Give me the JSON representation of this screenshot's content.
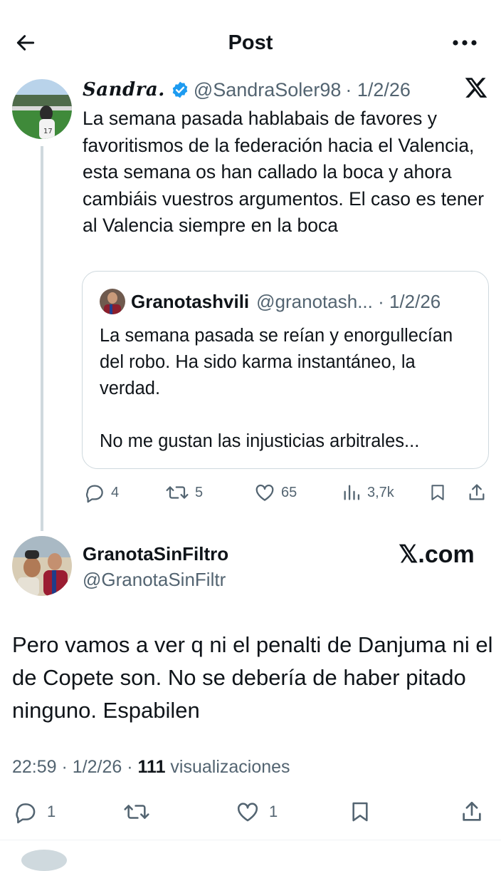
{
  "header": {
    "title": "Post"
  },
  "parent_tweet": {
    "name": "Sandra.",
    "handle": "@SandraSoler98",
    "date": "· 1/2/26",
    "text": "La semana pasada hablabais de favores y favoritismos de la federación hacia el Valencia, esta semana os han callado la boca y ahora cambiáis vuestros argumentos. El caso es tener al Valencia siempre en la boca",
    "quoted": {
      "name": "Granotashvili",
      "handle_date": "@granotash... · 1/2/26",
      "text": "La semana pasada se reían y enorgullecían del robo. Ha sido karma instantáneo, la verdad.\n\nNo me gustan las injusticias arbitrales..."
    },
    "actions": {
      "replies": "4",
      "reposts": "5",
      "likes": "65",
      "views": "3,7k"
    }
  },
  "reply_tweet": {
    "name": "GranotaSinFiltro",
    "handle": "@GranotaSinFiltr",
    "brand": "𝕏.com",
    "text": "Pero vamos a ver q ni el penalti de Danjuma ni el de Copete son. No se debería de haber pitado ninguno. Espabilen",
    "time_date": "22:59 · 1/2/26 · ",
    "views_count": "111",
    "views_label": " visualizaciones",
    "actions": {
      "replies": "1",
      "likes": "1"
    }
  },
  "colors": {
    "text": "#0f1419",
    "muted": "#536471",
    "verified": "#1d9bf0",
    "border": "#cfd9de"
  },
  "icons": [
    "back-arrow-icon",
    "more-icon",
    "verified-badge-icon",
    "x-logo-icon",
    "reply-icon",
    "repost-icon",
    "like-icon",
    "views-icon",
    "bookmark-icon",
    "share-icon"
  ]
}
